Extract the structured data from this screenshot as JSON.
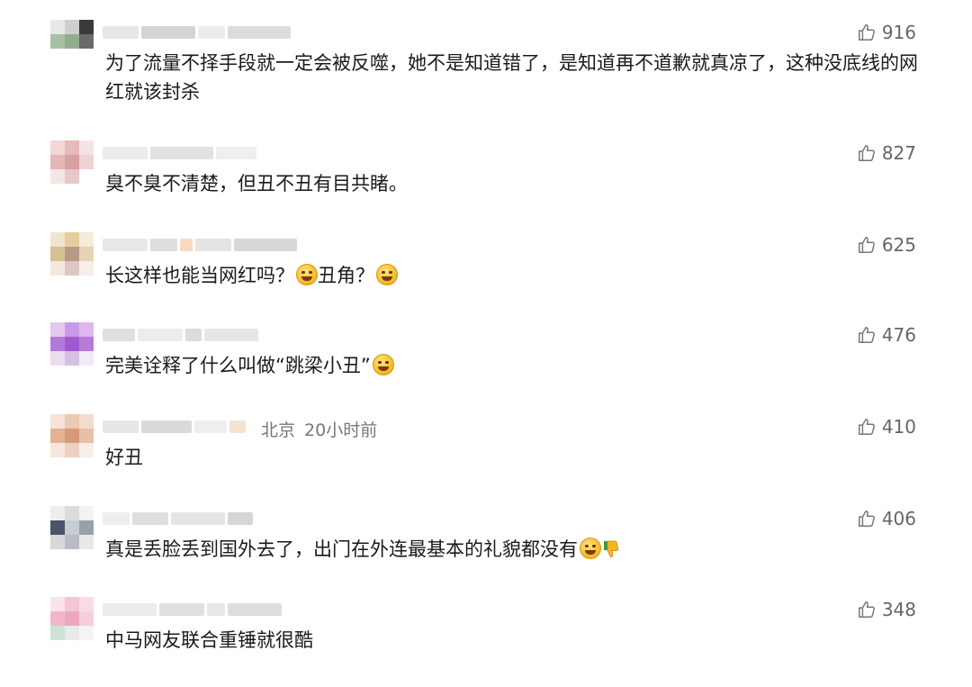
{
  "colors": {
    "text": "#1a1a1a",
    "meta": "#777777",
    "like": "#666666",
    "accent_emoji": "#f5b51e"
  },
  "comments": [
    {
      "location": "",
      "time": "",
      "likes": "916",
      "text": "为了流量不择手段就一定会被反噬，她不是知道错了，是知道再不道歉就真凉了，这种没底线的网红就该封杀",
      "emojis": []
    },
    {
      "location": "",
      "time": "",
      "likes": "827",
      "text": "臭不臭不清楚，但丑不丑有目共睹。",
      "emojis": []
    },
    {
      "location": "",
      "time": "",
      "likes": "625",
      "text_parts": [
        "长这样也能当网红吗？",
        "丑角？"
      ],
      "emojis": [
        "laugh-cry-emoji",
        "laugh-cry-emoji"
      ]
    },
    {
      "location": "",
      "time": "",
      "likes": "476",
      "text": "完美诠释了什么叫做“跳梁小丑”",
      "emojis": [
        "smile-emoji"
      ]
    },
    {
      "location": "北京",
      "time": "20小时前",
      "likes": "410",
      "text": "好丑",
      "emojis": []
    },
    {
      "location": "",
      "time": "",
      "likes": "406",
      "text": "真是丢脸丢到国外去了，出门在外连最基本的礼貌都没有",
      "emojis": [
        "grin-emoji",
        "thumbs-down-emoji"
      ]
    },
    {
      "location": "",
      "time": "",
      "likes": "348",
      "text": "中马网友联合重锤就很酷",
      "emojis": []
    }
  ]
}
